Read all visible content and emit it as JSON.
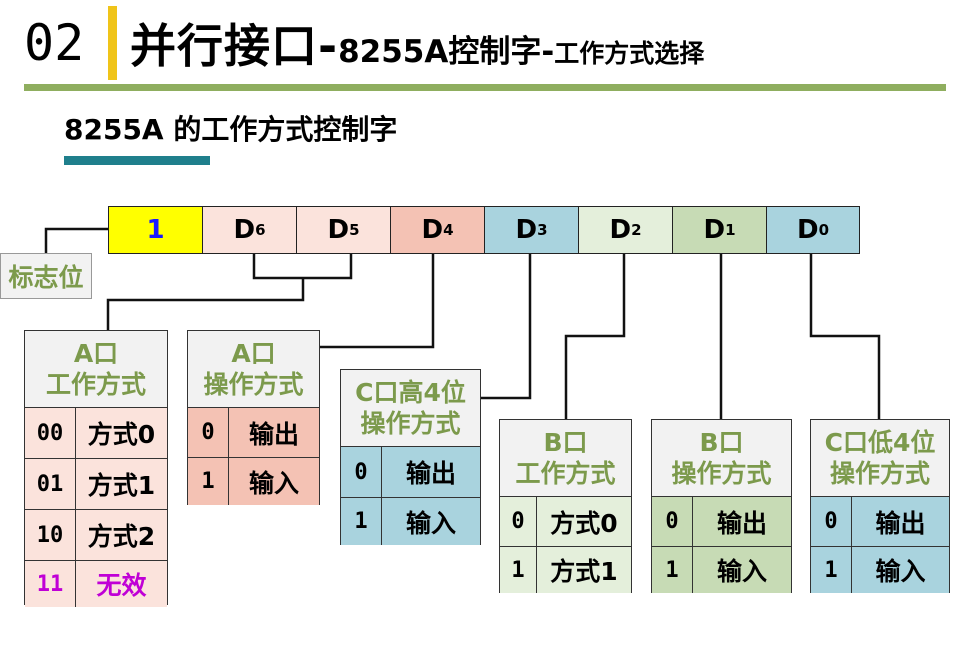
{
  "header": {
    "number": "02",
    "title_main": "并行接口",
    "title_dash1": "-",
    "title_mid": "8255A控制字",
    "title_dash2": "-",
    "title_small": "工作方式选择"
  },
  "subtitle": "8255A 的工作方式控制字",
  "colors": {
    "accent_yellow": "#f0c419",
    "green_line": "#8fae5f",
    "teal_bar": "#1f7f8c",
    "header_text": "#7c9a4c",
    "bit_flag": "#ffff00",
    "bit_d65": "#fbe3dc",
    "bit_d4": "#f4c2b4",
    "bit_d3": "#a9d3de",
    "bit_d2": "#e4efdb",
    "bit_d1": "#c7dbb5",
    "bit_d0": "#a9d3de",
    "invalid": "#c000d6"
  },
  "register": {
    "bits": [
      {
        "label": "1",
        "sub": ""
      },
      {
        "label": "D",
        "sub": "6"
      },
      {
        "label": "D",
        "sub": "5"
      },
      {
        "label": "D",
        "sub": "4"
      },
      {
        "label": "D",
        "sub": "3"
      },
      {
        "label": "D",
        "sub": "2"
      },
      {
        "label": "D",
        "sub": "1"
      },
      {
        "label": "D",
        "sub": "0"
      }
    ]
  },
  "flag_label": "标志位",
  "tables": {
    "a_mode": {
      "header1": "A口",
      "header2": "工作方式",
      "rows": [
        {
          "code": "00",
          "text": "方式0"
        },
        {
          "code": "01",
          "text": "方式1"
        },
        {
          "code": "10",
          "text": "方式2"
        },
        {
          "code": "11",
          "text": "无效"
        }
      ]
    },
    "a_io": {
      "header1": "A口",
      "header2": "操作方式",
      "rows": [
        {
          "code": "0",
          "text": "输出"
        },
        {
          "code": "1",
          "text": "输入"
        }
      ]
    },
    "c_high": {
      "header1": "C口高4位",
      "header2": "操作方式",
      "rows": [
        {
          "code": "0",
          "text": "输出"
        },
        {
          "code": "1",
          "text": "输入"
        }
      ]
    },
    "b_mode": {
      "header1": "B口",
      "header2": "工作方式",
      "rows": [
        {
          "code": "0",
          "text": "方式0"
        },
        {
          "code": "1",
          "text": "方式1"
        }
      ]
    },
    "b_io": {
      "header1": "B口",
      "header2": "操作方式",
      "rows": [
        {
          "code": "0",
          "text": "输出"
        },
        {
          "code": "1",
          "text": "输入"
        }
      ]
    },
    "c_low": {
      "header1": "C口低4位",
      "header2": "操作方式",
      "rows": [
        {
          "code": "0",
          "text": "输出"
        },
        {
          "code": "1",
          "text": "输入"
        }
      ]
    }
  }
}
